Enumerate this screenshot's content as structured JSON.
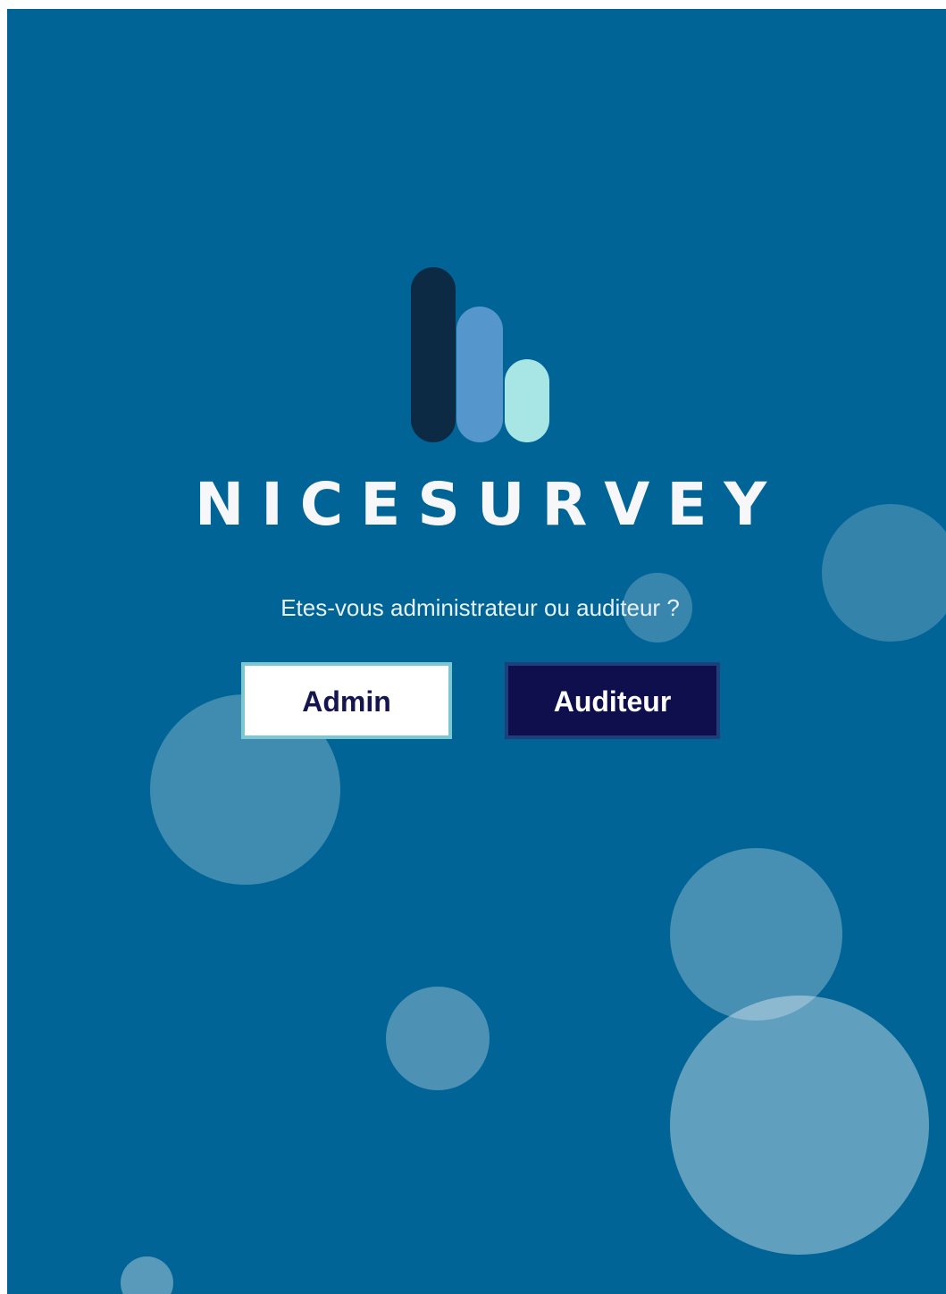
{
  "brand": {
    "name": "NICESURVEY",
    "logo_icon": "bar-chart-logo-icon",
    "logo_colors": [
      "#0d2a45",
      "#5597cc",
      "#a8e6e6"
    ]
  },
  "prompt": {
    "question": "Etes-vous administrateur ou auditeur ?"
  },
  "buttons": {
    "admin_label": "Admin",
    "auditeur_label": "Auditeur"
  },
  "colors": {
    "background": "#006496",
    "admin_button_bg": "#ffffff",
    "admin_button_text": "#15154f",
    "auditeur_button_bg": "#0f0f4d",
    "auditeur_button_text": "#ffffff"
  }
}
